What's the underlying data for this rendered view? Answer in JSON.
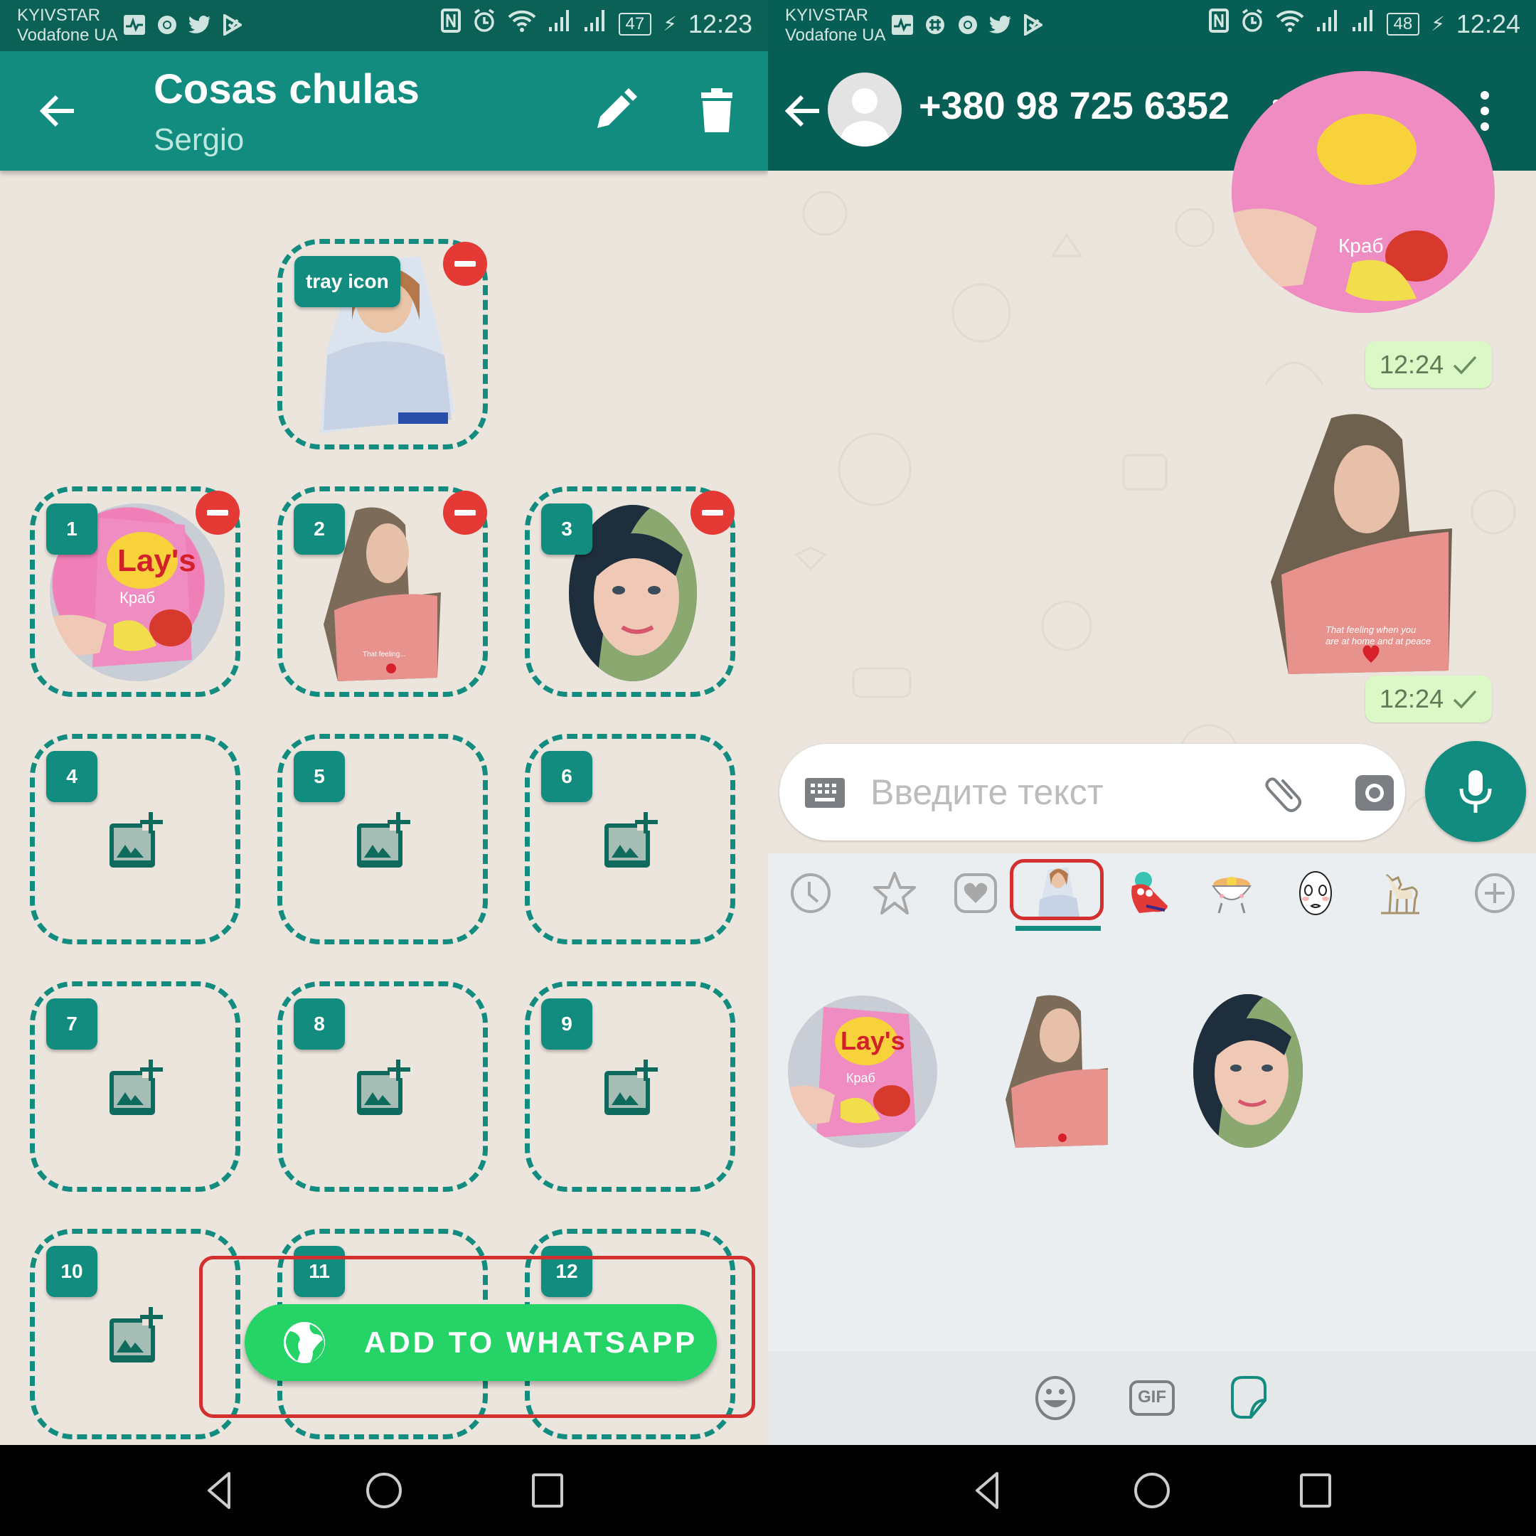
{
  "left": {
    "status": {
      "carrier1": "KYIVSTAR",
      "carrier2": "Vodafone UA",
      "battery": "47",
      "time": "12:23",
      "apps": [
        "pulse-icon",
        "chrome-icon",
        "twitter-icon",
        "feedly-icon"
      ]
    },
    "appbar": {
      "title": "Cosas chulas",
      "subtitle": "Sergio",
      "actions": [
        "edit-icon",
        "delete-icon"
      ]
    },
    "tray_label": "tray icon",
    "slots": [
      {
        "number": "1",
        "filled": true,
        "content": "Lay's Краб chips sticker"
      },
      {
        "number": "2",
        "filled": true,
        "content": "Woman in pink sticker"
      },
      {
        "number": "3",
        "filled": true,
        "content": "Woman face oval sticker"
      },
      {
        "number": "4",
        "filled": false
      },
      {
        "number": "5",
        "filled": false
      },
      {
        "number": "6",
        "filled": false
      },
      {
        "number": "7",
        "filled": false
      },
      {
        "number": "8",
        "filled": false
      },
      {
        "number": "9",
        "filled": false
      },
      {
        "number": "10",
        "filled": false
      },
      {
        "number": "11",
        "filled": false
      },
      {
        "number": "12",
        "filled": false
      }
    ],
    "add_button": "ADD TO WHATSAPP"
  },
  "right": {
    "status": {
      "carrier1": "KYIVSTAR",
      "carrier2": "Vodafone UA",
      "battery": "48",
      "time": "12:24",
      "apps": [
        "pulse-icon",
        "slack-icon",
        "chrome-icon",
        "twitter-icon",
        "feedly-icon"
      ]
    },
    "contact": "+380 98 725 6352",
    "messages": [
      {
        "type": "sticker",
        "content": "Lay's Краб chips",
        "time": "12:24",
        "status": "sent"
      },
      {
        "type": "sticker",
        "content": "Woman in pink — That feeling when you are at home and at peace",
        "time": "12:24",
        "status": "sent"
      }
    ],
    "sticker_caption": "That feeling when you are at home and at peace",
    "chips_text": "Краб",
    "compose_placeholder": "Введите текст",
    "tray_tabs": [
      "recent",
      "favorites",
      "love",
      "Cosas chulas",
      "red-creature pack",
      "bowl pack",
      "face pack",
      "dog pack",
      "add"
    ],
    "active_tab": "Cosas chulas",
    "bottom_tabs": [
      "emoji",
      "GIF",
      "stickers"
    ],
    "gif_label": "GIF",
    "active_bottom": "stickers"
  },
  "colors": {
    "teal": "#128c7e",
    "dark_teal": "#075e54",
    "green": "#25d366",
    "red": "#e53935",
    "bubble": "#dcf8c6"
  }
}
